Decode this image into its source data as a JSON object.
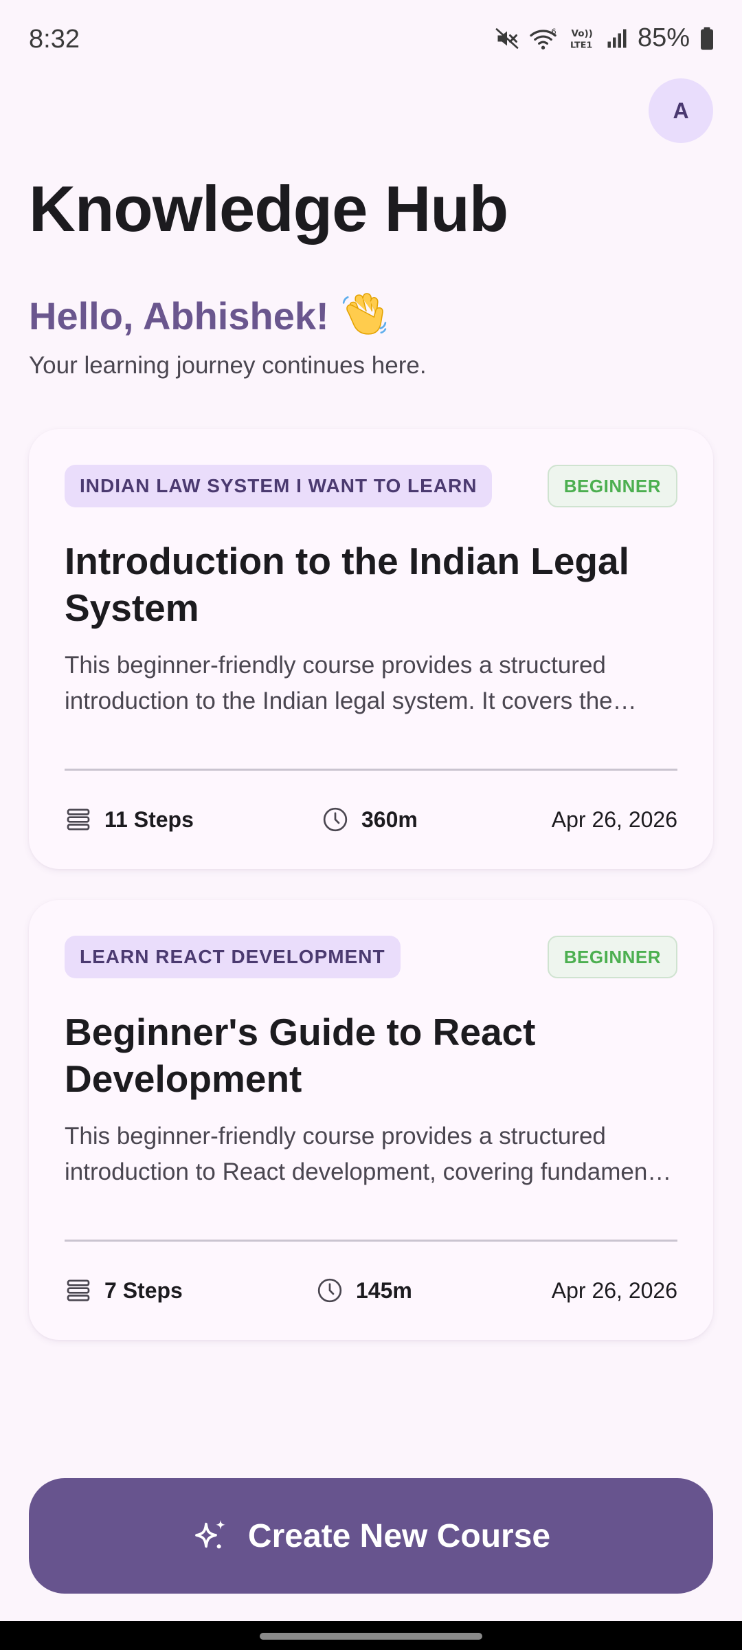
{
  "status_bar": {
    "time": "8:32",
    "battery": "85%",
    "icons": [
      "mute-icon",
      "wifi-icon",
      "volte-icon",
      "signal-icon",
      "battery-icon"
    ],
    "volte_label": "Vo)) LTE1",
    "wifi_label": "6"
  },
  "header": {
    "avatar_initial": "A",
    "title": "Knowledge Hub"
  },
  "greeting": {
    "text": "Hello, Abhishek!",
    "emoji": "👋",
    "subtitle": "Your learning journey continues here."
  },
  "courses": [
    {
      "category": "INDIAN LAW SYSTEM I WANT TO LEARN",
      "level": "BEGINNER",
      "title": "Introduction to the Indian Legal System",
      "description": "This beginner-friendly course provides a structured introduction to the Indian legal system. It covers the foundational structure, key institutions, and the sources of law in India.",
      "steps": "11 Steps",
      "duration": "360m",
      "date": "Apr 26, 2026"
    },
    {
      "category": "LEARN REACT DEVELOPMENT",
      "level": "BEGINNER",
      "title": "Beginner's Guide to React Development",
      "description": "This beginner-friendly course provides a structured introduction to React development, covering fundamental concepts such as components, props, state, and hooks.",
      "steps": "7 Steps",
      "duration": "145m",
      "date": "Apr 26, 2026"
    }
  ],
  "create_button": {
    "label": "Create New Course",
    "icon": "sparkle-icon"
  },
  "colors": {
    "background": "#FCF5FC",
    "primary": "#67548E",
    "greeting": "#6A568E",
    "chip_bg": "#EADDFB",
    "chip_text": "#4B3A70",
    "badge_green": "#4CAF50",
    "avatar_bg": "#E9DDFC"
  }
}
